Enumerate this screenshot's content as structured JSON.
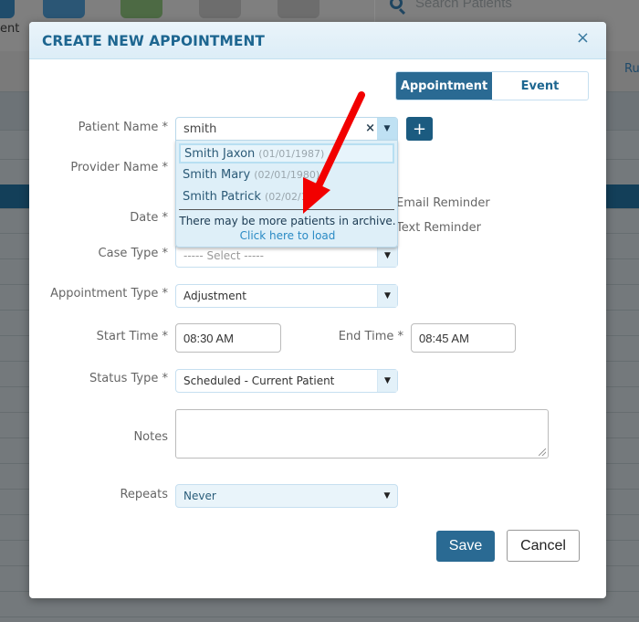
{
  "background": {
    "search_placeholder": "Search Patients",
    "left_partial_label": "ent",
    "right_partial_label": "Ru",
    "app_icons": [
      {
        "name": "appointment-app-icon",
        "color": "#1f4c6b"
      },
      {
        "name": "edit-note-app-icon",
        "color": "#2b5675"
      },
      {
        "name": "health-app-icon",
        "color": "#4d6a44"
      },
      {
        "name": "globe-app-icon",
        "color": "#6d6d6d"
      },
      {
        "name": "refresh-target-app-icon",
        "color": "#6d6d6d"
      }
    ]
  },
  "modal": {
    "title": "CREATE NEW APPOINTMENT",
    "close_icon": "×",
    "mode_toggle": {
      "options": [
        "Appointment",
        "Event"
      ],
      "selected": "Appointment"
    },
    "fields": {
      "patient_name": {
        "label": "Patient Name *",
        "value": "smith",
        "clear_icon": "×",
        "add_icon": "+",
        "suggestions": [
          {
            "name": "Smith Jaxon",
            "dob": "(01/01/1987)",
            "highlighted": true
          },
          {
            "name": "Smith Mary",
            "dob": "(02/01/1980)",
            "highlighted": false
          },
          {
            "name": "Smith Patrick",
            "dob": "(02/02/19",
            "highlighted": false
          }
        ],
        "archive_message": "There may be more patients in archive.",
        "archive_link": "Click here to load"
      },
      "provider_name": {
        "label": "Provider Name *"
      },
      "date": {
        "label": "Date *"
      },
      "email_reminder": {
        "label": "Email Reminder"
      },
      "text_reminder": {
        "label": "Text Reminder"
      },
      "case_type": {
        "label": "Case Type *",
        "placeholder": "----- Select -----"
      },
      "appointment_type": {
        "label": "Appointment Type *",
        "value": "Adjustment"
      },
      "start_time": {
        "label": "Start Time *",
        "value": "08:30 AM"
      },
      "end_time": {
        "label": "End Time *",
        "value": "08:45 AM"
      },
      "status_type": {
        "label": "Status Type *",
        "value": "Scheduled - Current Patient"
      },
      "notes": {
        "label": "Notes",
        "value": ""
      },
      "repeats": {
        "label": "Repeats",
        "value": "Never"
      }
    },
    "buttons": {
      "save": "Save",
      "cancel": "Cancel"
    },
    "dropdown_arrow": "▼"
  },
  "annotation": {
    "type": "red-arrow",
    "color": "#f20000",
    "points_to": "archive-message"
  }
}
